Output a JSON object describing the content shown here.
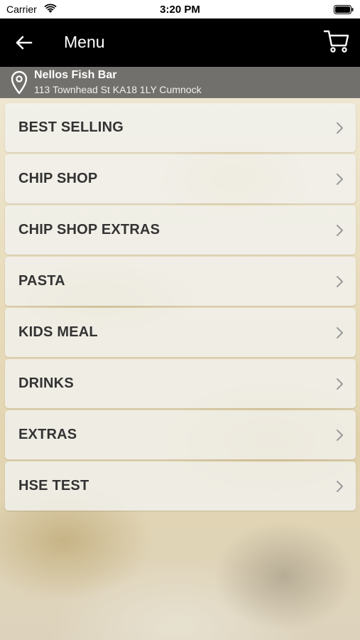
{
  "status_bar": {
    "carrier": "Carrier",
    "time": "3:20 PM",
    "wifi_icon": "wifi-icon",
    "battery_icon": "battery-icon"
  },
  "nav": {
    "title": "Menu",
    "back_icon": "arrow-left-icon",
    "cart_icon": "cart-icon"
  },
  "location": {
    "icon": "map-pin-icon",
    "name": "Nellos Fish Bar",
    "address": "113 Townhead St KA18 1LY Cumnock"
  },
  "menu": {
    "chevron_icon": "chevron-right-icon",
    "items": [
      {
        "label": "BEST SELLING"
      },
      {
        "label": "CHIP SHOP"
      },
      {
        "label": "CHIP SHOP EXTRAS"
      },
      {
        "label": "PASTA"
      },
      {
        "label": "KIDS MEAL"
      },
      {
        "label": "DRINKS"
      },
      {
        "label": "EXTRAS"
      },
      {
        "label": "HSE TEST"
      }
    ]
  },
  "colors": {
    "nav_background": "#000000",
    "location_background": "#555555",
    "item_text": "#333333"
  }
}
